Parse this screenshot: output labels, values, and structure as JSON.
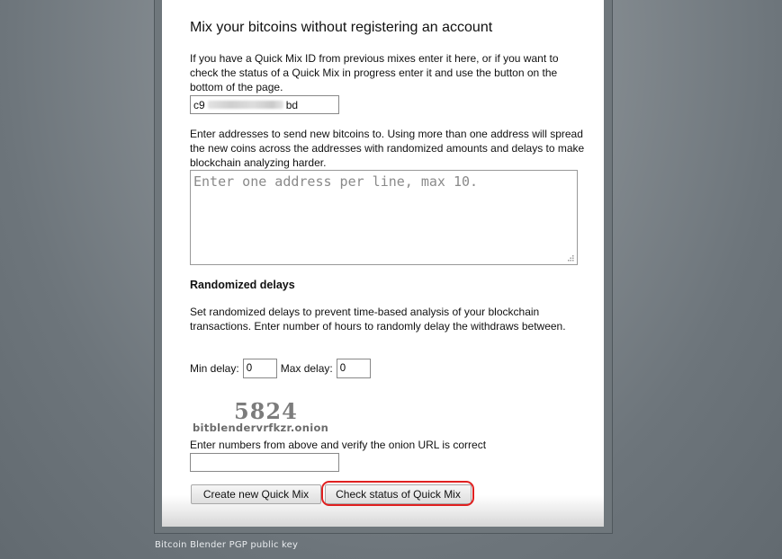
{
  "form": {
    "heading": "Mix your bitcoins without registering an account",
    "quickmix_description": "If you have a Quick Mix ID from previous mixes enter it here, or if you want to check the status of a Quick Mix in progress enter it and use the button on the bottom of the page.",
    "quickmix_id_prefix": "c9",
    "quickmix_id_suffix": "bd",
    "addresses_description": "Enter addresses to send new bitcoins to. Using more than one address will spread the new coins across the addresses with randomized amounts and delays to make blockchain analyzing harder.",
    "addresses_placeholder": "Enter one address per line, max 10.",
    "delays_heading": "Randomized delays",
    "delays_description": "Set randomized delays to prevent time-based analysis of your blockchain transactions. Enter number of hours to randomly delay the withdraws between.",
    "min_delay_label": "Min delay:",
    "min_delay_value": "0",
    "max_delay_label": "Max delay:",
    "max_delay_value": "0",
    "captcha_digits": "5824",
    "captcha_onion": "bitblendervrfkzr.onion",
    "captcha_label": "Enter numbers from above and verify the onion URL is correct",
    "create_button": "Create new Quick Mix",
    "check_button": "Check status of Quick Mix"
  },
  "footer": {
    "pgp_link": "Bitcoin Blender PGP public key"
  },
  "colors": {
    "background": "#6d757b",
    "panel": "#ffffff",
    "highlight": "#e02020"
  }
}
